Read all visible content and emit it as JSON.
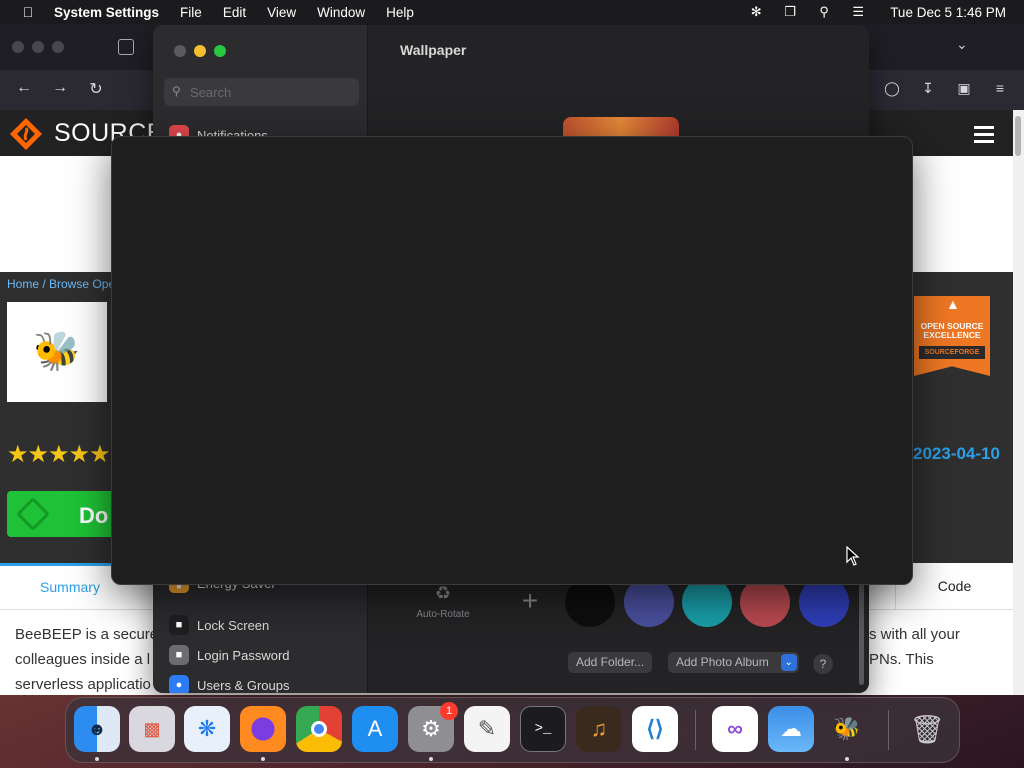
{
  "menubar": {
    "app_name": "System Settings",
    "menus": [
      "File",
      "Edit",
      "View",
      "Window",
      "Help"
    ],
    "clock": "Tue Dec 5  1:46 PM"
  },
  "browser": {
    "site_name": "SOURCEF",
    "breadcrumb": "Home / Browse Ope",
    "rating_stars": "★★★★★",
    "date": "2023-04-10",
    "download_label": "Do",
    "badge_line1": "OPEN SOURCE",
    "badge_line2": "EXCELLENCE",
    "badge_brand": "SOURCEFORGE",
    "tabs": {
      "summary": "Summary",
      "code": "Code"
    },
    "description_left": [
      "BeeBEEP is a secure",
      "colleagues inside a l",
      "serverless applicatio"
    ],
    "description_right": [
      "s with all your",
      "PNs. This",
      ""
    ]
  },
  "settings": {
    "search_placeholder": "Search",
    "title": "Wallpaper",
    "sidebar": [
      {
        "label": "Notifications",
        "color": "#e5484d"
      },
      {
        "label": "Energy Saver",
        "color": "#f0a030"
      },
      {
        "label": "Lock Screen",
        "color": "#2c2b2e"
      },
      {
        "label": "Login Password",
        "color": "#6b6b70"
      },
      {
        "label": "Users & Groups",
        "color": "#2d7cf6"
      }
    ],
    "auto_rotate_label": "Auto-Rotate",
    "add_folder_label": "Add Folder...",
    "add_album_label": "Add Photo Album",
    "help_label": "?",
    "swatch_colors": [
      "#0e0e0f",
      "#4a4f9c",
      "#1a9ea8",
      "#b84a50",
      "#2f3fb8"
    ]
  },
  "dock": {
    "notification_count": "1",
    "apps": [
      "Finder",
      "Launchpad",
      "Safari",
      "Firefox",
      "Chrome",
      "App Store",
      "System Settings",
      "TextEdit",
      "Terminal",
      "GarageBand",
      "VS Code",
      "Visual Studio",
      "Weather",
      "BeeBEEP",
      "Trash"
    ]
  }
}
